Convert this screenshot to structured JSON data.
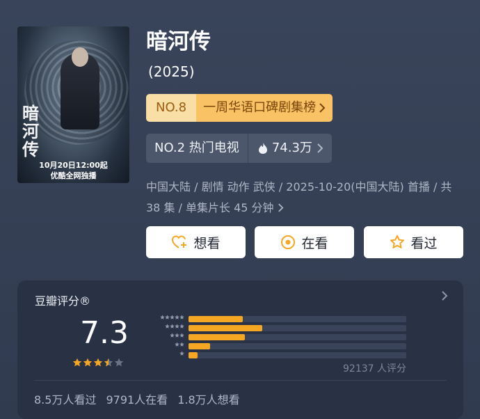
{
  "poster": {
    "title_vertical": "暗\n河\n传",
    "date": "10月20日12:00起",
    "exclusive": "优酷全网独播"
  },
  "title": "暗河传",
  "year": "(2025)",
  "rank1": {
    "no": "NO.8",
    "name": "一周华语口碑剧集榜"
  },
  "rank2": {
    "hot": "NO.2 热门电视",
    "heat": "74.3万"
  },
  "meta": "中国大陆 / 剧情 动作 武侠 / 2025-10-20(中国大陆) 首播 / 共 38 集 / 单集片长 45 分钟",
  "buttons": {
    "want": "想看",
    "watching": "在看",
    "watched": "看过"
  },
  "rating": {
    "title": "豆瓣评分®",
    "score": "7.3",
    "stars": 3.5,
    "distribution": [
      0.25,
      0.34,
      0.26,
      0.1,
      0.04
    ],
    "votes": "92137 人评分",
    "watched": "8.5万人看过",
    "watching": "9791人在看",
    "want": "1.8万人想看"
  },
  "colors": {
    "accent": "#f5a623",
    "rank_gold": "#f8c265",
    "bg": "#39445a",
    "panel": "#293245"
  },
  "icons": {
    "want": "heart-plus-icon",
    "watching": "target-icon",
    "watched": "star-icon",
    "heat": "flame-icon"
  }
}
